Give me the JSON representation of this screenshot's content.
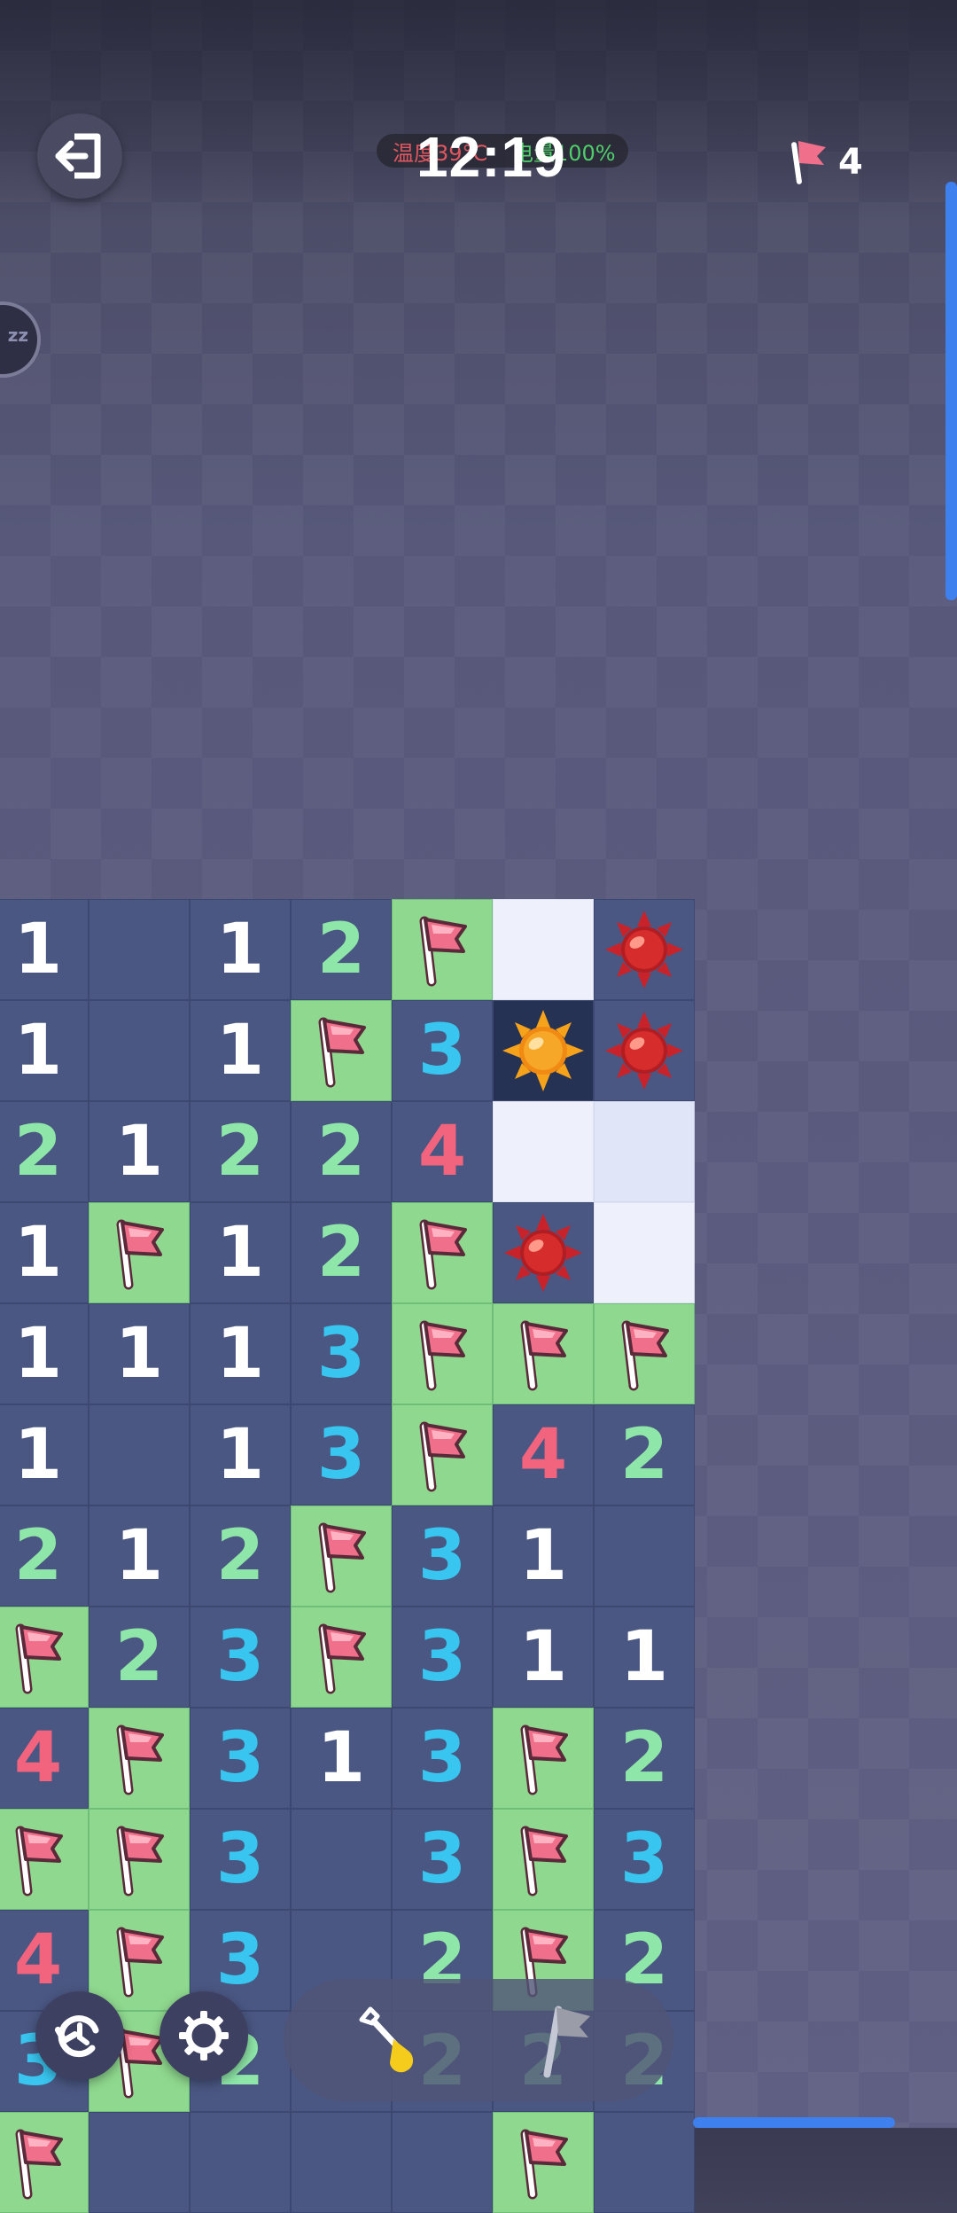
{
  "status_bar": {
    "temperature": "温度39°C",
    "battery": "电量100%"
  },
  "header": {
    "timer": "12:19",
    "flag_count": "4"
  },
  "board": {
    "rows": [
      [
        {
          "t": "num",
          "v": "1"
        },
        {
          "t": "empty"
        },
        {
          "t": "num",
          "v": "1"
        },
        {
          "t": "num",
          "v": "2"
        },
        {
          "t": "flag"
        },
        {
          "t": "white"
        },
        {
          "t": "mine"
        }
      ],
      [
        {
          "t": "num",
          "v": "1"
        },
        {
          "t": "empty"
        },
        {
          "t": "num",
          "v": "1"
        },
        {
          "t": "flag"
        },
        {
          "t": "num",
          "v": "3"
        },
        {
          "t": "boom"
        },
        {
          "t": "mine"
        }
      ],
      [
        {
          "t": "num",
          "v": "2"
        },
        {
          "t": "num",
          "v": "1"
        },
        {
          "t": "num",
          "v": "2"
        },
        {
          "t": "num",
          "v": "2"
        },
        {
          "t": "num",
          "v": "4"
        },
        {
          "t": "white"
        },
        {
          "t": "light"
        }
      ],
      [
        {
          "t": "num",
          "v": "1"
        },
        {
          "t": "flag"
        },
        {
          "t": "num",
          "v": "1"
        },
        {
          "t": "num",
          "v": "2"
        },
        {
          "t": "flag"
        },
        {
          "t": "mine"
        },
        {
          "t": "white"
        }
      ],
      [
        {
          "t": "num",
          "v": "1"
        },
        {
          "t": "num",
          "v": "1"
        },
        {
          "t": "num",
          "v": "1"
        },
        {
          "t": "num",
          "v": "3"
        },
        {
          "t": "flag"
        },
        {
          "t": "flag"
        },
        {
          "t": "flag"
        }
      ],
      [
        {
          "t": "num",
          "v": "1"
        },
        {
          "t": "empty"
        },
        {
          "t": "num",
          "v": "1"
        },
        {
          "t": "num",
          "v": "3"
        },
        {
          "t": "flag"
        },
        {
          "t": "num",
          "v": "4"
        },
        {
          "t": "num",
          "v": "2"
        }
      ],
      [
        {
          "t": "num",
          "v": "2"
        },
        {
          "t": "num",
          "v": "1"
        },
        {
          "t": "num",
          "v": "2"
        },
        {
          "t": "flag"
        },
        {
          "t": "num",
          "v": "3"
        },
        {
          "t": "num",
          "v": "1"
        },
        {
          "t": "empty"
        }
      ],
      [
        {
          "t": "flag"
        },
        {
          "t": "num",
          "v": "2"
        },
        {
          "t": "num",
          "v": "3"
        },
        {
          "t": "flag"
        },
        {
          "t": "num",
          "v": "3"
        },
        {
          "t": "num",
          "v": "1"
        },
        {
          "t": "num",
          "v": "1"
        }
      ],
      [
        {
          "t": "num",
          "v": "4"
        },
        {
          "t": "flag"
        },
        {
          "t": "num",
          "v": "3"
        },
        {
          "t": "num",
          "v": "1"
        },
        {
          "t": "num",
          "v": "3"
        },
        {
          "t": "flag"
        },
        {
          "t": "num",
          "v": "2"
        }
      ],
      [
        {
          "t": "flag"
        },
        {
          "t": "flag"
        },
        {
          "t": "num",
          "v": "3"
        },
        {
          "t": "empty"
        },
        {
          "t": "num",
          "v": "3"
        },
        {
          "t": "flag"
        },
        {
          "t": "num",
          "v": "3"
        }
      ],
      [
        {
          "t": "num",
          "v": "4"
        },
        {
          "t": "flag"
        },
        {
          "t": "num",
          "v": "3"
        },
        {
          "t": "empty"
        },
        {
          "t": "num",
          "v": "2"
        },
        {
          "t": "flag"
        },
        {
          "t": "num",
          "v": "2"
        }
      ],
      [
        {
          "t": "num",
          "v": "3"
        },
        {
          "t": "flag"
        },
        {
          "t": "num",
          "v": "2"
        },
        {
          "t": "empty"
        },
        {
          "t": "num",
          "v": "2"
        },
        {
          "t": "num",
          "v": "2"
        },
        {
          "t": "num",
          "v": "2"
        }
      ],
      [
        {
          "t": "flag"
        },
        {
          "t": "empty"
        },
        {
          "t": "empty"
        },
        {
          "t": "empty"
        },
        {
          "t": "empty"
        },
        {
          "t": "flag"
        },
        {
          "t": "empty"
        }
      ]
    ]
  },
  "icons": {
    "exit": "exit-icon",
    "flag_counter": "flag-icon",
    "sleep": "sleep-icon",
    "restart": "restart-icon",
    "settings": "gear-icon",
    "dig": "shovel-icon",
    "flag_mode": "flag-mode-icon"
  },
  "colors": {
    "number_1": "#ffffff",
    "number_2": "#8ee6a8",
    "number_3": "#38c5ef",
    "number_4": "#f2647e",
    "flag_tile": "#8fd88f",
    "revealed_tile": "#4a5782",
    "scrollbar": "#3e80ee"
  }
}
